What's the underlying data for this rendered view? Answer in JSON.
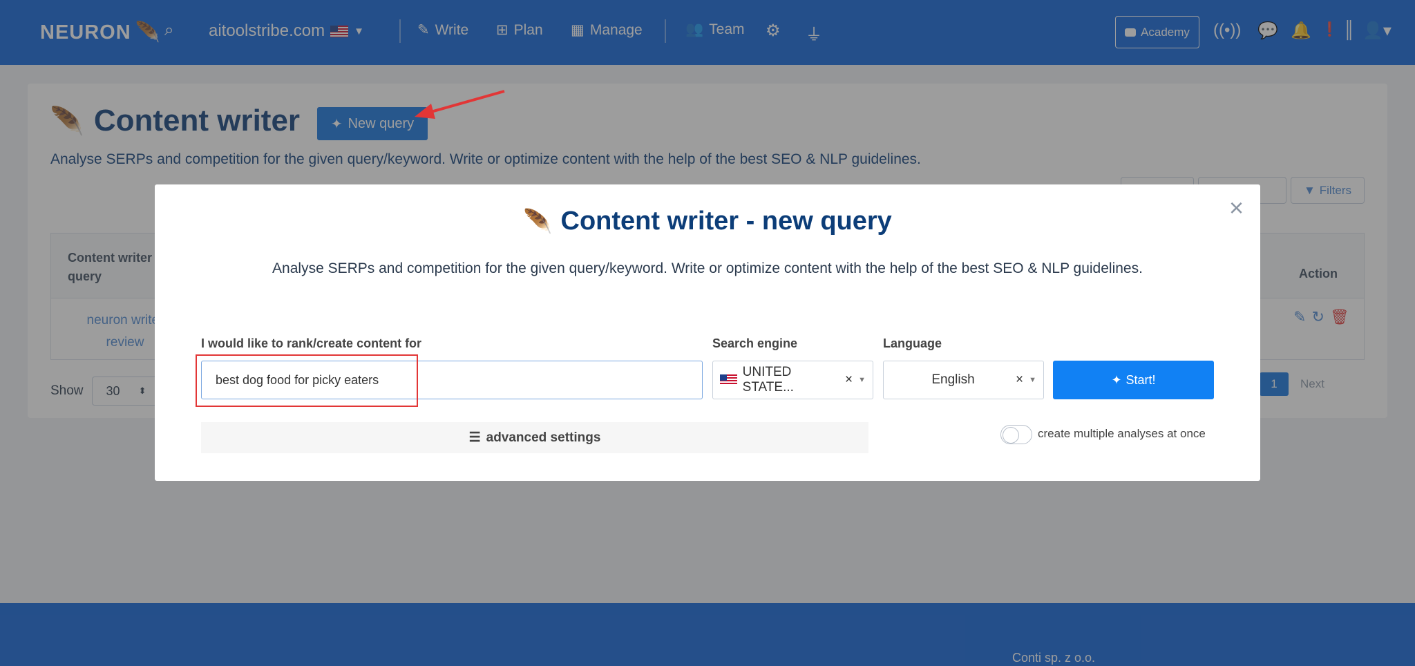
{
  "navbar": {
    "logo": "NEURON",
    "domain": "aitoolstribe.com",
    "items": [
      "Write",
      "Plan",
      "Manage",
      "Team"
    ],
    "academy": "Academy"
  },
  "page": {
    "title": "Content writer",
    "new_query": "New query",
    "subtitle": "Analyse SERPs and competition for the given query/keyword. Write or optimize content with the help of the best SEO & NLP guidelines.",
    "filters": [
      "Filters"
    ],
    "table": {
      "col_query": "Content writer query",
      "col_action": "Action",
      "row_query": "neuron writer review"
    },
    "show_label": "Show",
    "show_value": "30",
    "page_number": "1",
    "next": "Next"
  },
  "modal": {
    "title": "Content writer - new query",
    "subtitle": "Analyse SERPs and competition for the given query/keyword. Write or optimize content with the help of the best SEO & NLP guidelines.",
    "rank_label": "I would like to rank/create content for",
    "query_value": "best dog food for picky eaters",
    "engine_label": "Search engine",
    "engine_value": "UNITED STATE...",
    "language_label": "Language",
    "language_value": "English",
    "start": "Start!",
    "advanced": "advanced settings",
    "multiple": "create multiple analyses at once"
  },
  "footer": {
    "company": "Conti sp. z o.o."
  },
  "colors": {
    "brand": "#0d63d8",
    "accent": "#1181f4",
    "annotation": "#e23636"
  }
}
